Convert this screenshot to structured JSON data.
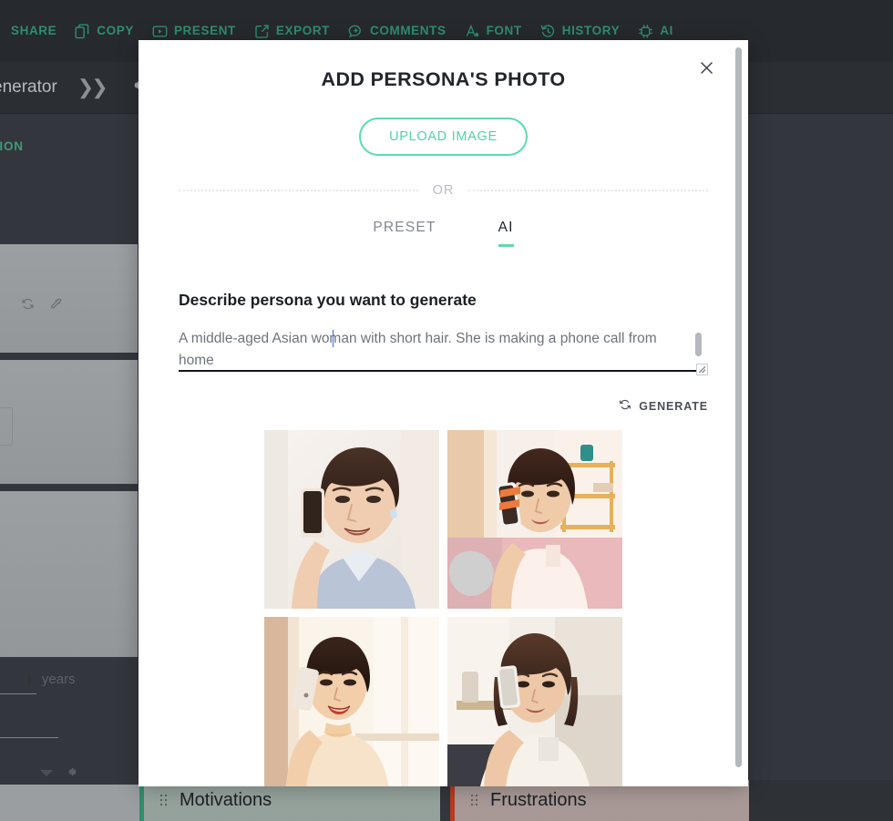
{
  "toolbar": {
    "items": [
      {
        "label": "SHARE",
        "icon": "share-icon"
      },
      {
        "label": "COPY",
        "icon": "copy-icon"
      },
      {
        "label": "PRESENT",
        "icon": "present-icon"
      },
      {
        "label": "EXPORT",
        "icon": "export-icon"
      },
      {
        "label": "COMMENTS",
        "icon": "comments-icon"
      },
      {
        "label": "FONT",
        "icon": "font-icon"
      },
      {
        "label": "HISTORY",
        "icon": "history-icon"
      },
      {
        "label": "AI",
        "icon": "ai-chip-icon"
      }
    ],
    "accent_color": "#2f8f6d"
  },
  "docbar": {
    "title": "enerator",
    "chevrons": "»",
    "gear_icon": "gear-icon"
  },
  "background": {
    "section_label": "IPTION",
    "years_label": "years",
    "sections": [
      {
        "label": "Motivations",
        "accent": "#2f8f6d"
      },
      {
        "label": "Frustrations",
        "accent": "#bb3a20"
      }
    ]
  },
  "modal": {
    "title": "ADD PERSONA'S PHOTO",
    "close_label": "✕",
    "upload_label": "UPLOAD IMAGE",
    "or_label": "OR",
    "tabs": [
      {
        "label": "PRESET",
        "active": false
      },
      {
        "label": "AI",
        "active": true
      }
    ],
    "describe_label": "Describe persona you want to generate",
    "prompt_value": "A middle-aged Asian woman with short hair. She is making a phone call from home",
    "prompt_placeholder": "Describe persona you want to generate",
    "generate_label": "GENERATE",
    "generate_icon": "refresh-icon",
    "accent_color": "#5ddbae",
    "results": [
      {
        "alt": "asian-woman-phone-call-1",
        "bg": "#f3eee9"
      },
      {
        "alt": "asian-woman-phone-call-2",
        "bg": "#f6e9e6"
      },
      {
        "alt": "asian-woman-phone-call-3",
        "bg": "#f7efe4"
      },
      {
        "alt": "asian-woman-phone-call-4",
        "bg": "#f4efe8"
      }
    ]
  }
}
